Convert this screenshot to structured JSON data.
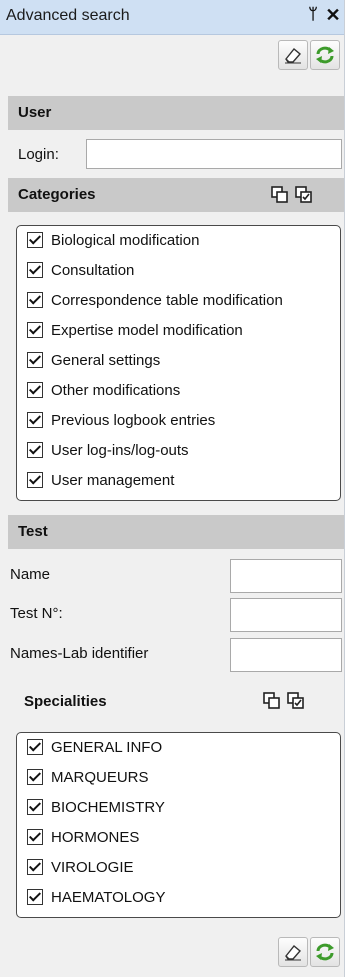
{
  "window": {
    "title": "Advanced search",
    "pin_glyph": "ᛘ",
    "close_glyph": "✕"
  },
  "toolbar_icons": [
    "eraser-icon",
    "refresh-icon"
  ],
  "user": {
    "heading": "User",
    "login_label": "Login:",
    "login_value": ""
  },
  "categories": {
    "heading": "Categories",
    "items": [
      {
        "label": "Biological modification",
        "checked": true
      },
      {
        "label": "Consultation",
        "checked": true
      },
      {
        "label": "Correspondence table modification",
        "checked": true
      },
      {
        "label": "Expertise model modification",
        "checked": true
      },
      {
        "label": "General settings",
        "checked": true
      },
      {
        "label": "Other modifications",
        "checked": true
      },
      {
        "label": "Previous logbook entries",
        "checked": true
      },
      {
        "label": "User log-ins/log-outs",
        "checked": true
      },
      {
        "label": "User management",
        "checked": true
      }
    ]
  },
  "test": {
    "heading": "Test",
    "name_label": "Name",
    "name_value": "",
    "test_no_label": "Test N°:",
    "test_no_value": "",
    "names_lab_label": "Names-Lab identifier",
    "names_lab_value": ""
  },
  "specialities": {
    "heading": "Specialities",
    "items": [
      {
        "label": "GENERAL INFO",
        "checked": true
      },
      {
        "label": "MARQUEURS",
        "checked": true
      },
      {
        "label": "BIOCHEMISTRY",
        "checked": true
      },
      {
        "label": "HORMONES",
        "checked": true
      },
      {
        "label": "VIROLOGIE",
        "checked": true
      },
      {
        "label": "HAEMATOLOGY",
        "checked": true
      }
    ]
  }
}
